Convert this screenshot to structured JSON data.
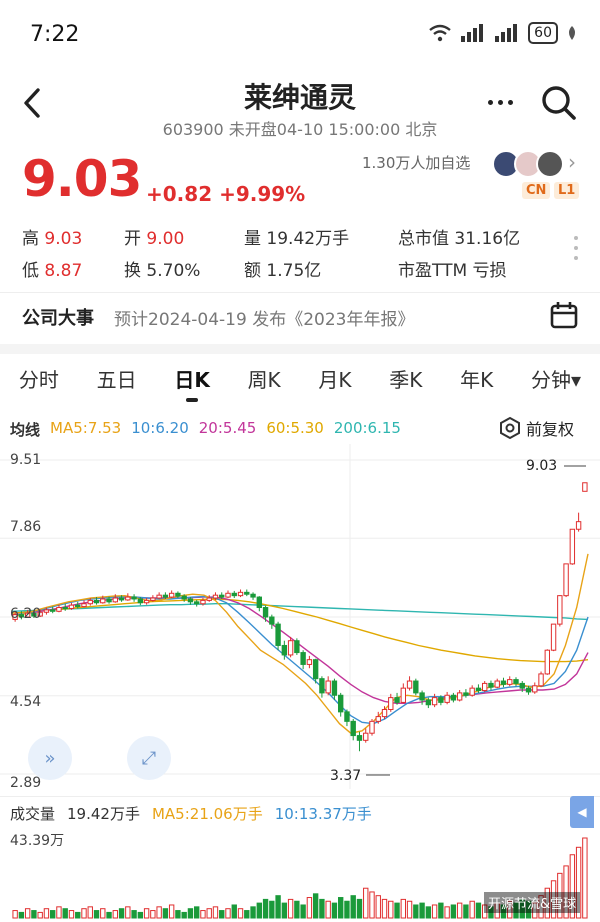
{
  "status_bar": {
    "time": "7:22",
    "battery": "60"
  },
  "header": {
    "title": "莱绅通灵",
    "subtitle": "603900 未开盘04-10 15:00:00 北京"
  },
  "quote": {
    "price": "9.03",
    "change": "+0.82",
    "change_pct": "+9.99%",
    "followers": "1.30万人加自选",
    "badges": [
      "CN",
      "L1"
    ],
    "stats": [
      {
        "label": "高",
        "value": "9.03",
        "tone": "red"
      },
      {
        "label": "开",
        "value": "9.00",
        "tone": "red"
      },
      {
        "label": "量",
        "value": "19.42万手",
        "tone": "plain"
      },
      {
        "label": "总市值",
        "value": "31.16亿",
        "tone": "plain"
      },
      {
        "label": "低",
        "value": "8.87",
        "tone": "red"
      },
      {
        "label": "换",
        "value": "5.70%",
        "tone": "plain"
      },
      {
        "label": "额",
        "value": "1.75亿",
        "tone": "plain"
      },
      {
        "label": "市盈TTM",
        "value": "亏损",
        "tone": "plain"
      }
    ]
  },
  "event": {
    "title": "公司大事",
    "text": "预计2024-04-19 发布《2023年年报》"
  },
  "tabs": [
    "分时",
    "五日",
    "日K",
    "周K",
    "月K",
    "季K",
    "年K",
    "分钟▾"
  ],
  "active_tab": "日K",
  "ma_legend": {
    "label": "均线",
    "items": [
      {
        "text": "MA5:7.53",
        "color": "#e8a317"
      },
      {
        "text": "10:6.20",
        "color": "#3a8fd0"
      },
      {
        "text": "20:5.45",
        "color": "#c2359a"
      },
      {
        "text": "60:5.30",
        "color": "#e0a800"
      },
      {
        "text": "200:6.15",
        "color": "#2fb6b0"
      }
    ]
  },
  "fuquan": "前复权",
  "price_axis": [
    "9.51",
    "7.86",
    "6.20",
    "4.54",
    "2.89"
  ],
  "annotations": {
    "high": "9.03",
    "low": "3.37"
  },
  "volume": {
    "label": "成交量",
    "value": "19.42万手",
    "ma5": "MA5:21.06万手",
    "ma10": "10:13.37万手",
    "axis_max": "43.39万"
  },
  "watermark": "开源节流&雪球",
  "colors": {
    "up": "#e02e2e",
    "down": "#1a9a3a",
    "ma5": "#e8a317",
    "ma10": "#3a8fd0",
    "ma20": "#c2359a",
    "ma60": "#e0a800",
    "ma200": "#2fb6b0"
  },
  "candles": [
    [
      6.15,
      6.25,
      6.3,
      6.1
    ],
    [
      6.25,
      6.2,
      6.32,
      6.15
    ],
    [
      6.2,
      6.28,
      6.35,
      6.18
    ],
    [
      6.28,
      6.22,
      6.33,
      6.18
    ],
    [
      6.22,
      6.3,
      6.36,
      6.2
    ],
    [
      6.3,
      6.35,
      6.4,
      6.25
    ],
    [
      6.35,
      6.32,
      6.42,
      6.28
    ],
    [
      6.32,
      6.4,
      6.46,
      6.3
    ],
    [
      6.4,
      6.38,
      6.48,
      6.33
    ],
    [
      6.38,
      6.45,
      6.5,
      6.35
    ],
    [
      6.45,
      6.42,
      6.52,
      6.38
    ],
    [
      6.42,
      6.48,
      6.55,
      6.4
    ],
    [
      6.48,
      6.55,
      6.6,
      6.44
    ],
    [
      6.55,
      6.5,
      6.62,
      6.46
    ],
    [
      6.5,
      6.58,
      6.65,
      6.48
    ],
    [
      6.58,
      6.52,
      6.63,
      6.48
    ],
    [
      6.52,
      6.6,
      6.68,
      6.5
    ],
    [
      6.6,
      6.56,
      6.66,
      6.52
    ],
    [
      6.56,
      6.62,
      6.7,
      6.54
    ],
    [
      6.62,
      6.58,
      6.68,
      6.52
    ],
    [
      6.58,
      6.5,
      6.62,
      6.45
    ],
    [
      6.5,
      6.55,
      6.6,
      6.46
    ],
    [
      6.55,
      6.6,
      6.66,
      6.52
    ],
    [
      6.6,
      6.66,
      6.72,
      6.58
    ],
    [
      6.66,
      6.62,
      6.72,
      6.58
    ],
    [
      6.62,
      6.7,
      6.76,
      6.6
    ],
    [
      6.7,
      6.64,
      6.74,
      6.6
    ],
    [
      6.64,
      6.58,
      6.68,
      6.52
    ],
    [
      6.58,
      6.52,
      6.62,
      6.46
    ],
    [
      6.52,
      6.48,
      6.56,
      6.42
    ],
    [
      6.48,
      6.55,
      6.6,
      6.44
    ],
    [
      6.55,
      6.6,
      6.66,
      6.52
    ],
    [
      6.6,
      6.66,
      6.72,
      6.56
    ],
    [
      6.66,
      6.62,
      6.72,
      6.58
    ],
    [
      6.62,
      6.7,
      6.76,
      6.6
    ],
    [
      6.7,
      6.65,
      6.75,
      6.6
    ],
    [
      6.65,
      6.72,
      6.78,
      6.62
    ],
    [
      6.72,
      6.68,
      6.78,
      6.64
    ],
    [
      6.68,
      6.62,
      6.72,
      6.56
    ],
    [
      6.62,
      6.4,
      6.64,
      6.32
    ],
    [
      6.4,
      6.2,
      6.44,
      6.1
    ],
    [
      6.2,
      6.05,
      6.25,
      5.95
    ],
    [
      6.05,
      5.6,
      6.1,
      5.5
    ],
    [
      5.6,
      5.4,
      5.7,
      5.3
    ],
    [
      5.4,
      5.7,
      5.78,
      5.35
    ],
    [
      5.7,
      5.45,
      5.75,
      5.4
    ],
    [
      5.45,
      5.2,
      5.5,
      5.1
    ],
    [
      5.2,
      5.3,
      5.38,
      5.12
    ],
    [
      5.3,
      4.9,
      5.32,
      4.8
    ],
    [
      4.9,
      4.6,
      4.95,
      4.5
    ],
    [
      4.6,
      4.85,
      4.95,
      4.55
    ],
    [
      4.85,
      4.55,
      4.9,
      4.45
    ],
    [
      4.55,
      4.2,
      4.6,
      4.1
    ],
    [
      4.2,
      4.0,
      4.25,
      3.9
    ],
    [
      4.0,
      3.7,
      4.05,
      3.6
    ],
    [
      3.7,
      3.6,
      3.78,
      3.37
    ],
    [
      3.6,
      3.75,
      3.85,
      3.55
    ],
    [
      3.75,
      4.0,
      4.05,
      3.7
    ],
    [
      4.0,
      4.1,
      4.2,
      3.95
    ],
    [
      4.1,
      4.25,
      4.32,
      4.05
    ],
    [
      4.25,
      4.5,
      4.58,
      4.2
    ],
    [
      4.5,
      4.4,
      4.6,
      4.35
    ],
    [
      4.4,
      4.7,
      4.8,
      4.38
    ],
    [
      4.7,
      4.85,
      4.95,
      4.65
    ],
    [
      4.85,
      4.6,
      4.9,
      4.55
    ],
    [
      4.6,
      4.45,
      4.65,
      4.35
    ],
    [
      4.45,
      4.35,
      4.5,
      4.28
    ],
    [
      4.35,
      4.5,
      4.58,
      4.3
    ],
    [
      4.5,
      4.4,
      4.55,
      4.34
    ],
    [
      4.4,
      4.55,
      4.62,
      4.36
    ],
    [
      4.55,
      4.45,
      4.6,
      4.4
    ],
    [
      4.45,
      4.6,
      4.66,
      4.42
    ],
    [
      4.6,
      4.55,
      4.68,
      4.5
    ],
    [
      4.55,
      4.7,
      4.76,
      4.52
    ],
    [
      4.7,
      4.65,
      4.78,
      4.6
    ],
    [
      4.65,
      4.8,
      4.85,
      4.62
    ],
    [
      4.8,
      4.72,
      4.86,
      4.66
    ],
    [
      4.72,
      4.85,
      4.9,
      4.7
    ],
    [
      4.85,
      4.78,
      4.92,
      4.72
    ],
    [
      4.78,
      4.88,
      4.95,
      4.74
    ],
    [
      4.88,
      4.8,
      4.93,
      4.74
    ],
    [
      4.8,
      4.7,
      4.85,
      4.62
    ],
    [
      4.7,
      4.62,
      4.75,
      4.56
    ],
    [
      4.62,
      4.75,
      4.82,
      4.58
    ],
    [
      4.75,
      5.0,
      5.05,
      4.72
    ],
    [
      5.0,
      5.5,
      5.52,
      4.98
    ],
    [
      5.5,
      6.05,
      6.05,
      5.48
    ],
    [
      6.05,
      6.65,
      6.66,
      6.0
    ],
    [
      6.65,
      7.32,
      7.32,
      6.62
    ],
    [
      7.32,
      8.05,
      8.05,
      7.3
    ],
    [
      8.05,
      8.21,
      8.4,
      8.0
    ],
    [
      8.85,
      9.03,
      9.03,
      8.87
    ]
  ],
  "ma_lines": {
    "ma5": [
      6.2,
      6.26,
      6.33,
      6.4,
      6.46,
      6.52,
      6.56,
      6.6,
      6.62,
      6.64,
      6.65,
      6.6,
      6.55,
      6.55,
      6.6,
      6.65,
      6.68,
      6.66,
      6.55,
      6.3,
      6.0,
      5.75,
      5.5,
      5.35,
      5.2,
      5.0,
      4.8,
      4.55,
      4.25,
      3.95,
      3.75,
      3.8,
      4.0,
      4.25,
      4.5,
      4.55,
      4.52,
      4.45,
      4.45,
      4.5,
      4.55,
      4.62,
      4.7,
      4.76,
      4.8,
      4.78,
      4.72,
      4.75,
      5.0,
      5.6,
      6.4,
      7.53
    ],
    "ma10": [
      6.22,
      6.27,
      6.32,
      6.38,
      6.44,
      6.5,
      6.55,
      6.58,
      6.6,
      6.62,
      6.63,
      6.62,
      6.6,
      6.58,
      6.58,
      6.6,
      6.62,
      6.63,
      6.6,
      6.5,
      6.3,
      6.08,
      5.85,
      5.62,
      5.42,
      5.22,
      5.02,
      4.82,
      4.6,
      4.35,
      4.12,
      3.98,
      3.95,
      4.05,
      4.22,
      4.38,
      4.48,
      4.52,
      4.52,
      4.52,
      4.54,
      4.58,
      4.63,
      4.68,
      4.72,
      4.74,
      4.74,
      4.74,
      4.8,
      5.05,
      5.5,
      6.2
    ],
    "ma20": [
      6.24,
      6.27,
      6.3,
      6.34,
      6.38,
      6.43,
      6.48,
      6.52,
      6.55,
      6.58,
      6.6,
      6.6,
      6.6,
      6.6,
      6.6,
      6.6,
      6.61,
      6.62,
      6.62,
      6.58,
      6.5,
      6.38,
      6.22,
      6.05,
      5.88,
      5.7,
      5.52,
      5.34,
      5.16,
      4.96,
      4.78,
      4.62,
      4.5,
      4.42,
      4.38,
      4.38,
      4.4,
      4.44,
      4.48,
      4.52,
      4.55,
      4.57,
      4.6,
      4.62,
      4.64,
      4.66,
      4.66,
      4.66,
      4.68,
      4.78,
      5.0,
      5.45
    ],
    "ma60": [
      6.28,
      6.3,
      6.32,
      6.34,
      6.36,
      6.38,
      6.4,
      6.42,
      6.44,
      6.46,
      6.48,
      6.5,
      6.52,
      6.53,
      6.54,
      6.55,
      6.56,
      6.57,
      6.58,
      6.57,
      6.55,
      6.52,
      6.48,
      6.43,
      6.38,
      6.32,
      6.26,
      6.2,
      6.13,
      6.06,
      5.99,
      5.92,
      5.85,
      5.78,
      5.72,
      5.66,
      5.6,
      5.55,
      5.5,
      5.46,
      5.42,
      5.38,
      5.35,
      5.32,
      5.3,
      5.28,
      5.27,
      5.26,
      5.26,
      5.26,
      5.27,
      5.3
    ],
    "ma200": [
      6.32,
      6.33,
      6.34,
      6.35,
      6.36,
      6.37,
      6.38,
      6.39,
      6.4,
      6.41,
      6.42,
      6.43,
      6.44,
      6.45,
      6.46,
      6.46,
      6.47,
      6.47,
      6.48,
      6.48,
      6.47,
      6.46,
      6.45,
      6.44,
      6.43,
      6.42,
      6.41,
      6.4,
      6.39,
      6.38,
      6.37,
      6.36,
      6.35,
      6.34,
      6.33,
      6.32,
      6.31,
      6.3,
      6.29,
      6.28,
      6.27,
      6.26,
      6.25,
      6.24,
      6.23,
      6.22,
      6.21,
      6.2,
      6.19,
      6.18,
      6.16,
      6.15
    ]
  },
  "volumes": [
    4,
    3,
    5,
    4,
    3,
    5,
    4,
    6,
    5,
    4,
    3,
    5,
    6,
    4,
    5,
    3,
    4,
    5,
    6,
    4,
    3,
    5,
    4,
    6,
    5,
    7,
    4,
    3,
    5,
    6,
    4,
    5,
    6,
    4,
    5,
    7,
    5,
    4,
    6,
    8,
    10,
    9,
    12,
    8,
    10,
    9,
    7,
    11,
    13,
    10,
    9,
    8,
    11,
    9,
    12,
    10,
    16,
    14,
    12,
    10,
    9,
    8,
    10,
    9,
    7,
    8,
    6,
    7,
    8,
    6,
    7,
    8,
    7,
    9,
    8,
    7,
    6,
    8,
    7,
    9,
    8,
    10,
    9,
    8,
    12,
    16,
    20,
    24,
    28,
    34,
    38,
    43
  ]
}
